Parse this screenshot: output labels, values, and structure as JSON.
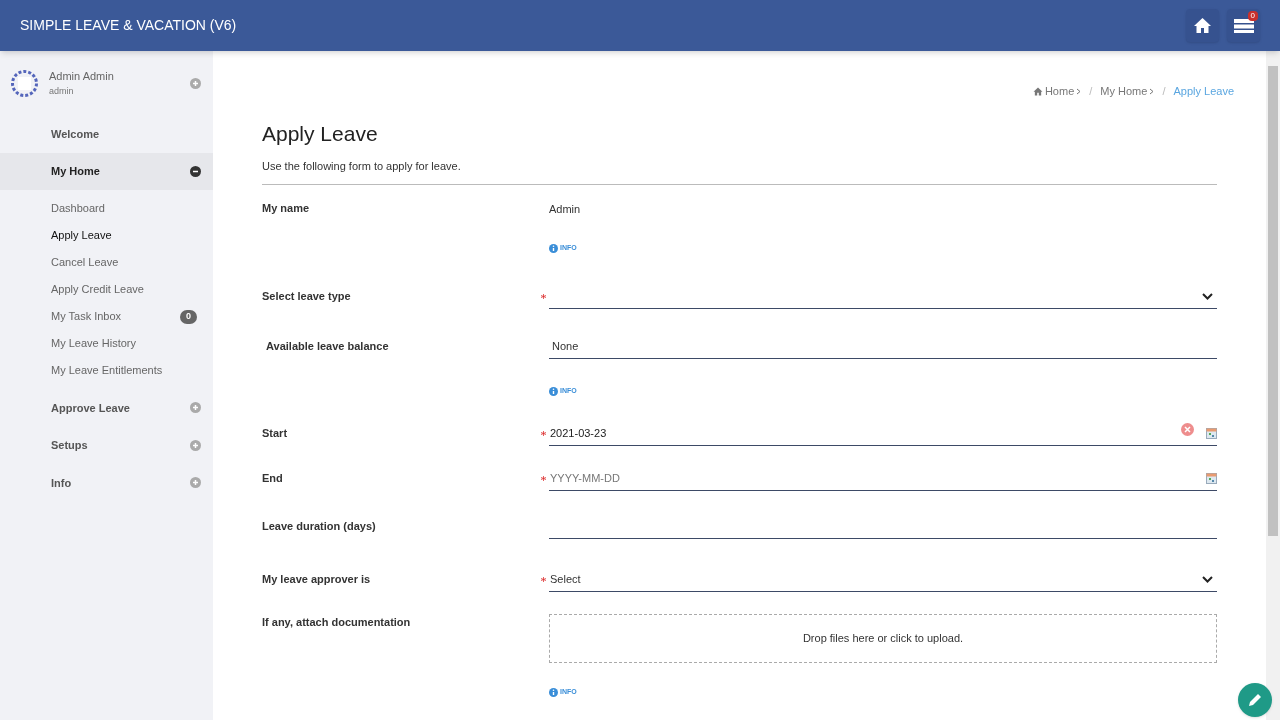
{
  "app_title": "SIMPLE LEAVE & VACATION (V6)",
  "header_buttons": [
    {
      "kind": "home"
    },
    {
      "kind": "tasks",
      "badge": "0"
    }
  ],
  "user": {
    "name": "Admin Admin",
    "login": "admin"
  },
  "sidebar": {
    "items": [
      {
        "label": "Welcome",
        "expandable": false,
        "expanded": false,
        "selected": false
      },
      {
        "label": "My Home",
        "expandable": true,
        "expanded": true,
        "selected": false,
        "children": [
          {
            "label": "Dashboard",
            "selected": false
          },
          {
            "label": "Apply Leave",
            "selected": true
          },
          {
            "label": "Cancel Leave",
            "selected": false
          },
          {
            "label": "Apply Credit Leave",
            "selected": false
          },
          {
            "label": "My Task Inbox",
            "selected": false,
            "badge": "0"
          },
          {
            "label": "My Leave History",
            "selected": false
          },
          {
            "label": "My Leave Entitlements",
            "selected": false
          }
        ]
      },
      {
        "label": "Approve Leave",
        "expandable": true,
        "expanded": false,
        "selected": false
      },
      {
        "label": "Setups",
        "expandable": true,
        "expanded": false,
        "selected": false
      },
      {
        "label": "Info",
        "expandable": true,
        "expanded": false,
        "selected": false
      }
    ]
  },
  "breadcrumb": [
    {
      "label": "Home",
      "selected": false,
      "separator": "/"
    },
    {
      "label": "My Home",
      "selected": false,
      "separator": "/"
    },
    {
      "label": "Apply Leave",
      "selected": true
    }
  ],
  "page": {
    "title": "Apply Leave",
    "subtitle": "Use the following form to apply for leave."
  },
  "form": [
    {
      "kind": "static",
      "label": "My name",
      "value": "Admin"
    },
    {
      "kind": "info",
      "text": "INFO"
    },
    {
      "kind": "select",
      "label": "Select leave type",
      "required": true
    },
    {
      "kind": "input",
      "label": "Available leave balance",
      "required": false,
      "value": "None"
    },
    {
      "kind": "info",
      "text": "INFO"
    },
    {
      "kind": "date",
      "label": "Start",
      "required": true,
      "value": "2021-03-23",
      "clearable": true
    },
    {
      "kind": "date",
      "label": "End",
      "required": true,
      "placeholder": "YYYY-MM-DD",
      "clearable": false
    },
    {
      "kind": "input",
      "label": "Leave duration (days)",
      "required": false
    },
    {
      "kind": "select",
      "label": "My leave approver is",
      "required": true,
      "value": "Select"
    },
    {
      "kind": "dropzone",
      "label": "If any, attach documentation",
      "text": "Drop files here or click to upload."
    },
    {
      "kind": "info",
      "text": "INFO"
    }
  ]
}
